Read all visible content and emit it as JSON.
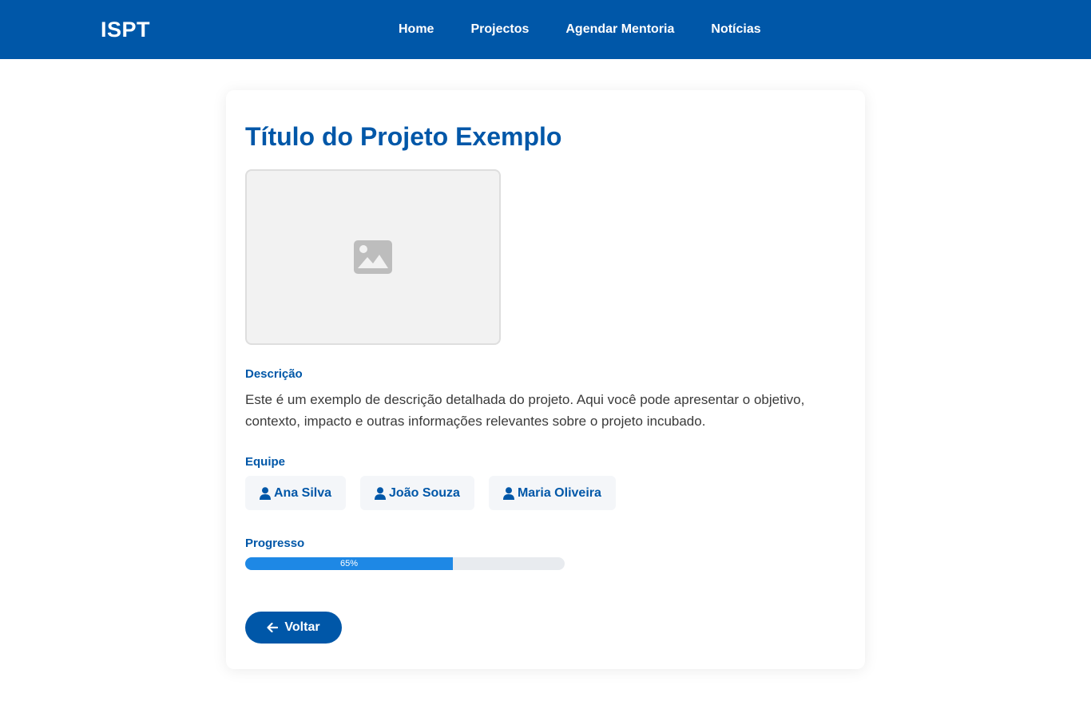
{
  "navbar": {
    "brand": "ISPT",
    "links": [
      "Home",
      "Projectos",
      "Agendar Mentoria",
      "Notícias"
    ],
    "color": "#0057a8"
  },
  "project": {
    "title": "Título do Projeto Exemplo",
    "image_icon": "image-placeholder-icon",
    "description_label": "Descrição",
    "description": "Este é um exemplo de descrição detalhada do projeto. Aqui você pode apresentar o objetivo, contexto, impacto e outras informações relevantes sobre o projeto incubado.",
    "team_label": "Equipe",
    "team": [
      "Ana Silva",
      "João Souza",
      "Maria Oliveira"
    ],
    "progress_label": "Progresso",
    "progress_value": 65,
    "progress_text": "65%",
    "back_label": "Voltar"
  }
}
